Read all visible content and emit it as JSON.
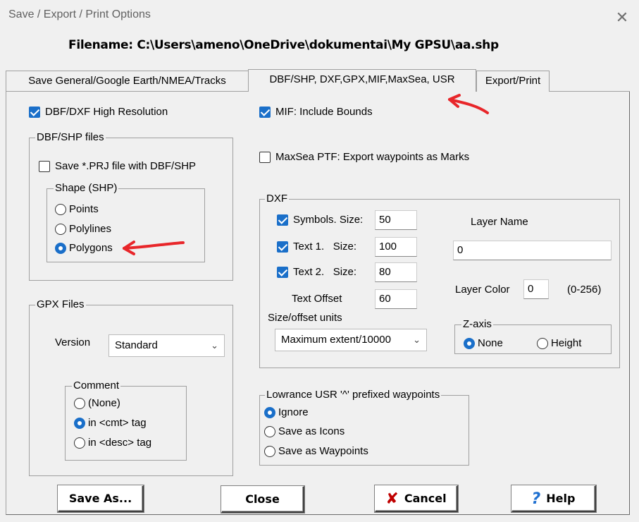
{
  "window": {
    "title": "Save / Export / Print Options",
    "close_glyph": "✕",
    "filename": "Filename: C:\\Users\\ameno\\OneDrive\\dokumentai\\My GPSU\\aa.shp"
  },
  "tabs": [
    {
      "label": "Save General/Google Earth/NMEA/Tracks",
      "active": false
    },
    {
      "label": "DBF/SHP, DXF,GPX,MIF,MaxSea, USR",
      "active": true
    },
    {
      "label": "Export/Print",
      "active": false
    }
  ],
  "options": {
    "dbf_dxf_high_res": {
      "label": "DBF/DXF High Resolution",
      "checked": true
    },
    "mif_bounds": {
      "label": "MIF: Include Bounds",
      "checked": true
    },
    "maxsea": {
      "label": "MaxSea PTF: Export waypoints as Marks",
      "checked": false
    }
  },
  "dbf_shp": {
    "title": "DBF/SHP files",
    "save_prj": {
      "label": "Save *.PRJ file with DBF/SHP",
      "checked": false
    },
    "shape_title": "Shape (SHP)",
    "shape_options": [
      "Points",
      "Polylines",
      "Polygons"
    ],
    "shape_selected": "Polygons"
  },
  "gpx": {
    "title": "GPX Files",
    "version_label": "Version",
    "version_value": "Standard",
    "comment_title": "Comment",
    "comment_options": [
      "(None)",
      "in <cmt> tag",
      "in <desc> tag"
    ],
    "comment_selected": "in <cmt> tag"
  },
  "dxf": {
    "title": "DXF",
    "symbols": {
      "label": "Symbols. Size:",
      "value": "50",
      "checked": true
    },
    "text1": {
      "label": "Text 1.   Size:",
      "value": "100",
      "checked": true
    },
    "text2": {
      "label": "Text 2.   Size:",
      "value": "80",
      "checked": true
    },
    "text_offset": {
      "label": "Text Offset",
      "value": "60"
    },
    "units_label": "Size/offset units",
    "units_value": "Maximum extent/10000",
    "layer_name_label": "Layer Name",
    "layer_name_value": "0",
    "layer_color_label": "Layer Color",
    "layer_color_value": "0",
    "layer_color_range": "(0-256)",
    "zaxis_title": "Z-axis",
    "zaxis_options": [
      "None",
      "Height"
    ],
    "zaxis_selected": "None"
  },
  "lowrance": {
    "title": "Lowrance USR '^' prefixed waypoints",
    "options": [
      "Ignore",
      "Save as Icons",
      "Save as Waypoints"
    ],
    "selected": "Ignore"
  },
  "buttons": {
    "save_as": "Save As...",
    "close": "Close",
    "cancel": "Cancel",
    "help": "Help"
  },
  "colors": {
    "accent": "#1a6fc9",
    "annotation_arrow": "#e8262a",
    "cancel_icon": "#c00000",
    "help_icon": "#1e6fd0"
  },
  "icons": {
    "cancel": "cancel-x-icon",
    "help": "question-mark-icon"
  }
}
